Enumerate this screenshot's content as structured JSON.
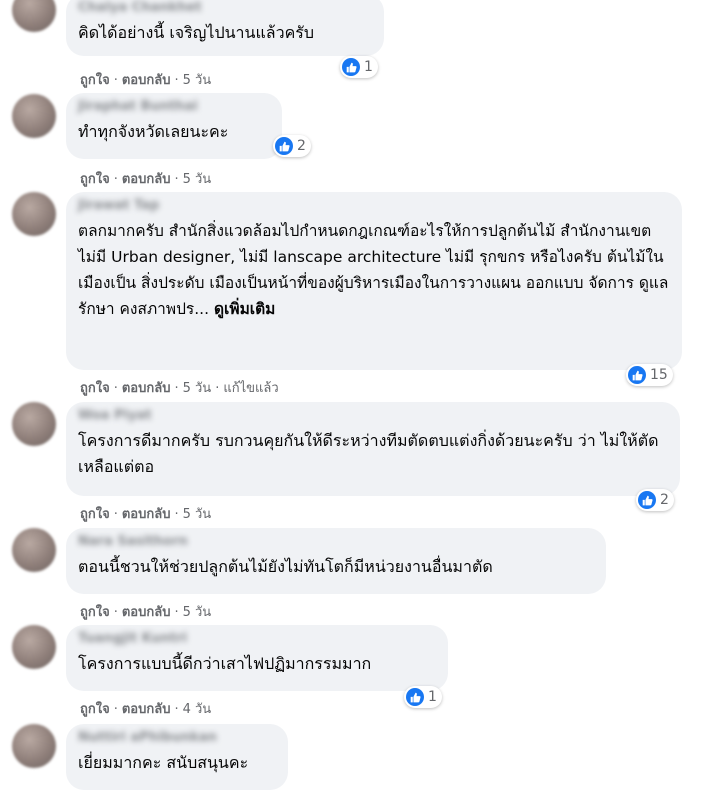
{
  "actions": {
    "like": "ถูกใจ",
    "reply": "ตอบกลับ",
    "separator": "·"
  },
  "colors": {
    "like_blue": "#1877f2",
    "bubble_bg": "#f0f2f5",
    "meta_gray": "#65676b"
  },
  "comments": [
    {
      "author": "Chalya Chankhet",
      "text": "คิดได้อย่างนี้ เจริญไปนานแล้วครับ",
      "time": "5 วัน",
      "reactions": "1",
      "reaction_icon": "like-icon"
    },
    {
      "author": "Jiraphat Bunthai",
      "text": "ทำทุกจังหวัดเลยนะคะ",
      "time": "5 วัน",
      "reactions": "2",
      "reaction_icon": "like-icon"
    },
    {
      "author": "Jirawat Tap",
      "text": "ตลกมากครับ สำนักสิ่งแวดล้อมไปกำหนดกฎเกณฑ์อะไรให้การปลูกต้นไม้ สำนักงานเขตไม่มี Urban designer, ไม่มี lanscape architecture ไม่มี รุกขกร หรือไงครับ ต้นไม้ในเมืองเป็น สิ่งประดับ เมืองเป็นหน้าที่ของผู้บริหารเมืองในการวางแผน ออกแบบ จัดการ ดูแลรักษา คงสภาพปร...",
      "see_more": "ดูเพิ่มเติม",
      "time": "5 วัน",
      "edited": "แก้ไขแล้ว",
      "reactions": "15",
      "reaction_icon": "like-icon"
    },
    {
      "author": "Woa Piyat",
      "text": "โครงการดีมากครับ รบกวนคุยกันให้ดีระหว่างทีมตัดตบแต่งกิ่งด้วยนะครับ ว่า ไม่ให้ตัดเหลือแต่ตอ",
      "time": "5 วัน",
      "reactions": "2",
      "reaction_icon": "like-icon"
    },
    {
      "author": "Nara Sasithorn",
      "text": "ตอนนี้ชวนให้ช่วยปลูกต้นไม้ยังไม่ทันโตก็มีหน่วยงานอื่นมาตัด",
      "time": "5 วัน"
    },
    {
      "author": "Tuangjit Kuntri",
      "text": "โครงการแบบนี้ดีกว่าเสาไฟปฏิมากรรมมาก",
      "time": "4 วัน",
      "reactions": "1",
      "reaction_icon": "like-icon"
    },
    {
      "author": "Nuttiri aPhibunkan",
      "text": "เยี่ยมมากคะ สนับสนุนคะ"
    }
  ]
}
